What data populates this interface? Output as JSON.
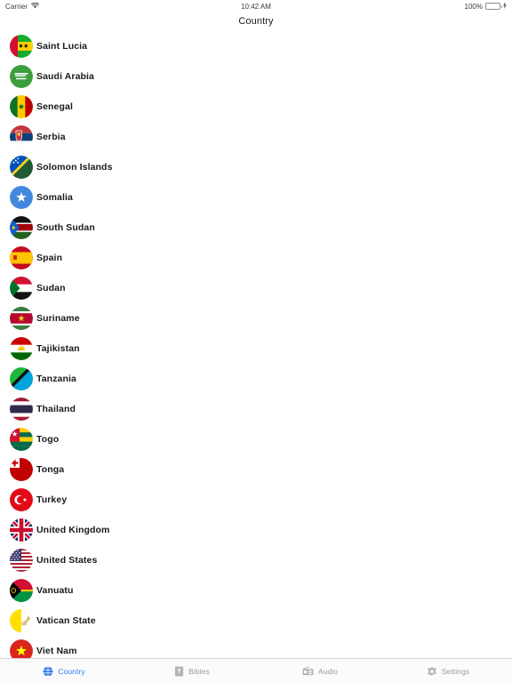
{
  "status_bar": {
    "carrier": "Carrier",
    "wifi_icon": "wifi-icon",
    "time": "10:42 AM",
    "battery_percent": "100%",
    "battery_icon": "battery-icon",
    "charging_icon": "bolt-icon",
    "battery_color": "#4cd964"
  },
  "nav": {
    "title": "Country"
  },
  "colors": {
    "accent": "#2f7ced",
    "tab_inactive": "#9b9b9f",
    "text": "#1a1a1a",
    "separator": "#d8d8dc"
  },
  "list": {
    "items": [
      {
        "name": "Saint Lucia",
        "flag": "flag-saint-lucia"
      },
      {
        "name": "Saudi Arabia",
        "flag": "flag-saudi-arabia"
      },
      {
        "name": "Senegal",
        "flag": "flag-senegal"
      },
      {
        "name": "Serbia",
        "flag": "flag-serbia"
      },
      {
        "name": "Solomon Islands",
        "flag": "flag-solomon-islands"
      },
      {
        "name": "Somalia",
        "flag": "flag-somalia"
      },
      {
        "name": "South Sudan",
        "flag": "flag-south-sudan"
      },
      {
        "name": "Spain",
        "flag": "flag-spain"
      },
      {
        "name": "Sudan",
        "flag": "flag-sudan"
      },
      {
        "name": "Suriname",
        "flag": "flag-suriname"
      },
      {
        "name": "Tajikistan",
        "flag": "flag-tajikistan"
      },
      {
        "name": "Tanzania",
        "flag": "flag-tanzania"
      },
      {
        "name": "Thailand",
        "flag": "flag-thailand"
      },
      {
        "name": "Togo",
        "flag": "flag-togo"
      },
      {
        "name": "Tonga",
        "flag": "flag-tonga"
      },
      {
        "name": "Turkey",
        "flag": "flag-turkey"
      },
      {
        "name": "United Kingdom",
        "flag": "flag-united-kingdom"
      },
      {
        "name": "United States",
        "flag": "flag-united-states"
      },
      {
        "name": "Vanuatu",
        "flag": "flag-vanuatu"
      },
      {
        "name": "Vatican State",
        "flag": "flag-vatican-state"
      },
      {
        "name": "Viet Nam",
        "flag": "flag-viet-nam"
      }
    ]
  },
  "tab_bar": {
    "tabs": [
      {
        "label": "Country",
        "icon": "globe-icon",
        "active": true
      },
      {
        "label": "Bibles",
        "icon": "book-icon",
        "active": false
      },
      {
        "label": "Audio",
        "icon": "radio-icon",
        "active": false
      },
      {
        "label": "Settings",
        "icon": "gear-icon",
        "active": false
      }
    ]
  }
}
